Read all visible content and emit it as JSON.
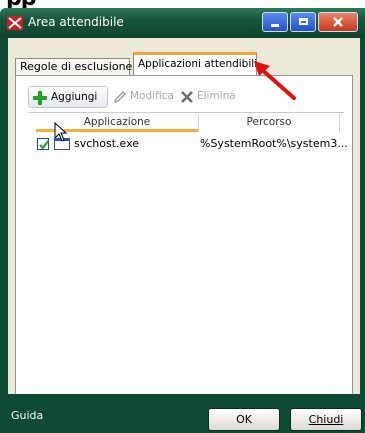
{
  "window": {
    "title": "Area attendibile"
  },
  "tabs": [
    {
      "label": "Regole di esclusione",
      "active": false
    },
    {
      "label": "Applicazioni attendibili",
      "active": true
    }
  ],
  "toolbar": {
    "add_label": "Aggiungi",
    "edit_label": "Modifica",
    "delete_label": "Elimina"
  },
  "table": {
    "columns": [
      "Applicazione",
      "Percorso"
    ],
    "rows": [
      {
        "checked": true,
        "name": "svchost.exe",
        "path": "%SystemRoot%\\system3..."
      }
    ]
  },
  "footer": {
    "help_label": "Guida",
    "ok_label": "OK",
    "close_label": "Chiudi"
  },
  "colors": {
    "frame": "#0e4a34",
    "tab_accent": "#f3a73a",
    "add_icon": "#2aa02a",
    "annotation_arrow": "#e01010"
  },
  "icons": [
    "app-icon",
    "add-icon",
    "edit-icon",
    "delete-icon",
    "file-icon",
    "check-icon",
    "cursor-icon",
    "annotation-arrow"
  ]
}
